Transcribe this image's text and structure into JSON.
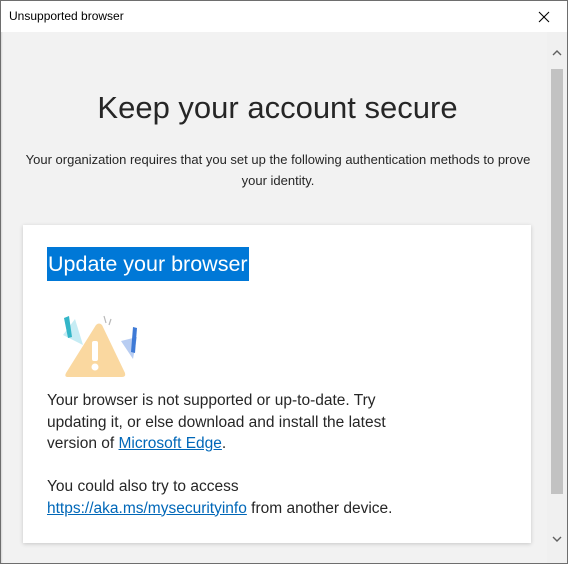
{
  "window": {
    "title": "Unsupported browser"
  },
  "page": {
    "heading": "Keep your account secure",
    "subheading": "Your organization requires that you set up the following authentication methods to prove your identity."
  },
  "card": {
    "title": "Update your browser",
    "illustration_icon": "warning-illustration-icon",
    "paragraph1_text": "Your browser is not supported or up-to-date. Try updating it, or else download and install the latest version of ",
    "paragraph1_link": "Microsoft Edge",
    "paragraph1_end": ".",
    "paragraph2_text": "You could also try to access ",
    "paragraph2_link": "https://aka.ms/mysecurityinfo",
    "paragraph2_end": " from another device."
  },
  "scrollbar": {
    "up_icon": "scroll-up-arrow-icon",
    "down_icon": "scroll-down-arrow-icon"
  },
  "colors": {
    "accent": "#0078d7",
    "link": "#0067b8",
    "background": "#f2f2f2",
    "warning": "#fad8a0"
  }
}
